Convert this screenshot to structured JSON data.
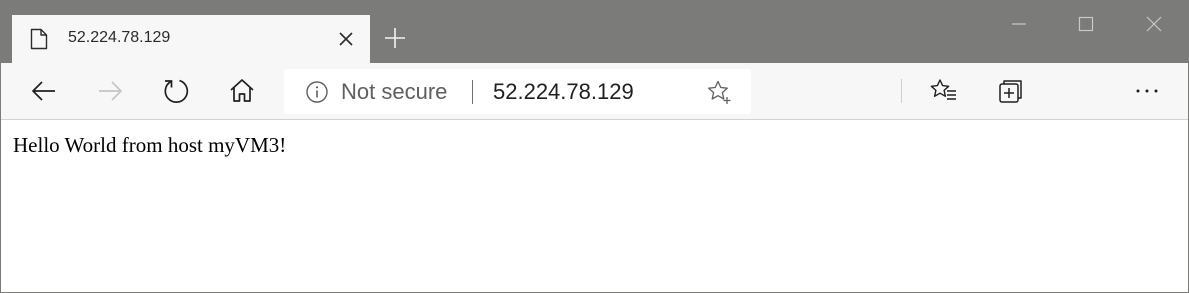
{
  "tab": {
    "title": "52.224.78.129",
    "icon": "page-icon"
  },
  "window_controls": [
    "minimize",
    "maximize",
    "close"
  ],
  "toolbar": {
    "buttons": [
      "back",
      "forward",
      "refresh",
      "home",
      "favorites",
      "collections",
      "more"
    ],
    "forward_enabled": false
  },
  "address_bar": {
    "security_label": "Not secure",
    "url": "52.224.78.129"
  },
  "page": {
    "body_text": "Hello World from host myVM3!"
  },
  "colors": {
    "tabstrip": "#7b7b79",
    "toolbar": "#f7f7f7",
    "icon": "#1f1f1f",
    "disabled_icon": "#c5c5c5"
  }
}
